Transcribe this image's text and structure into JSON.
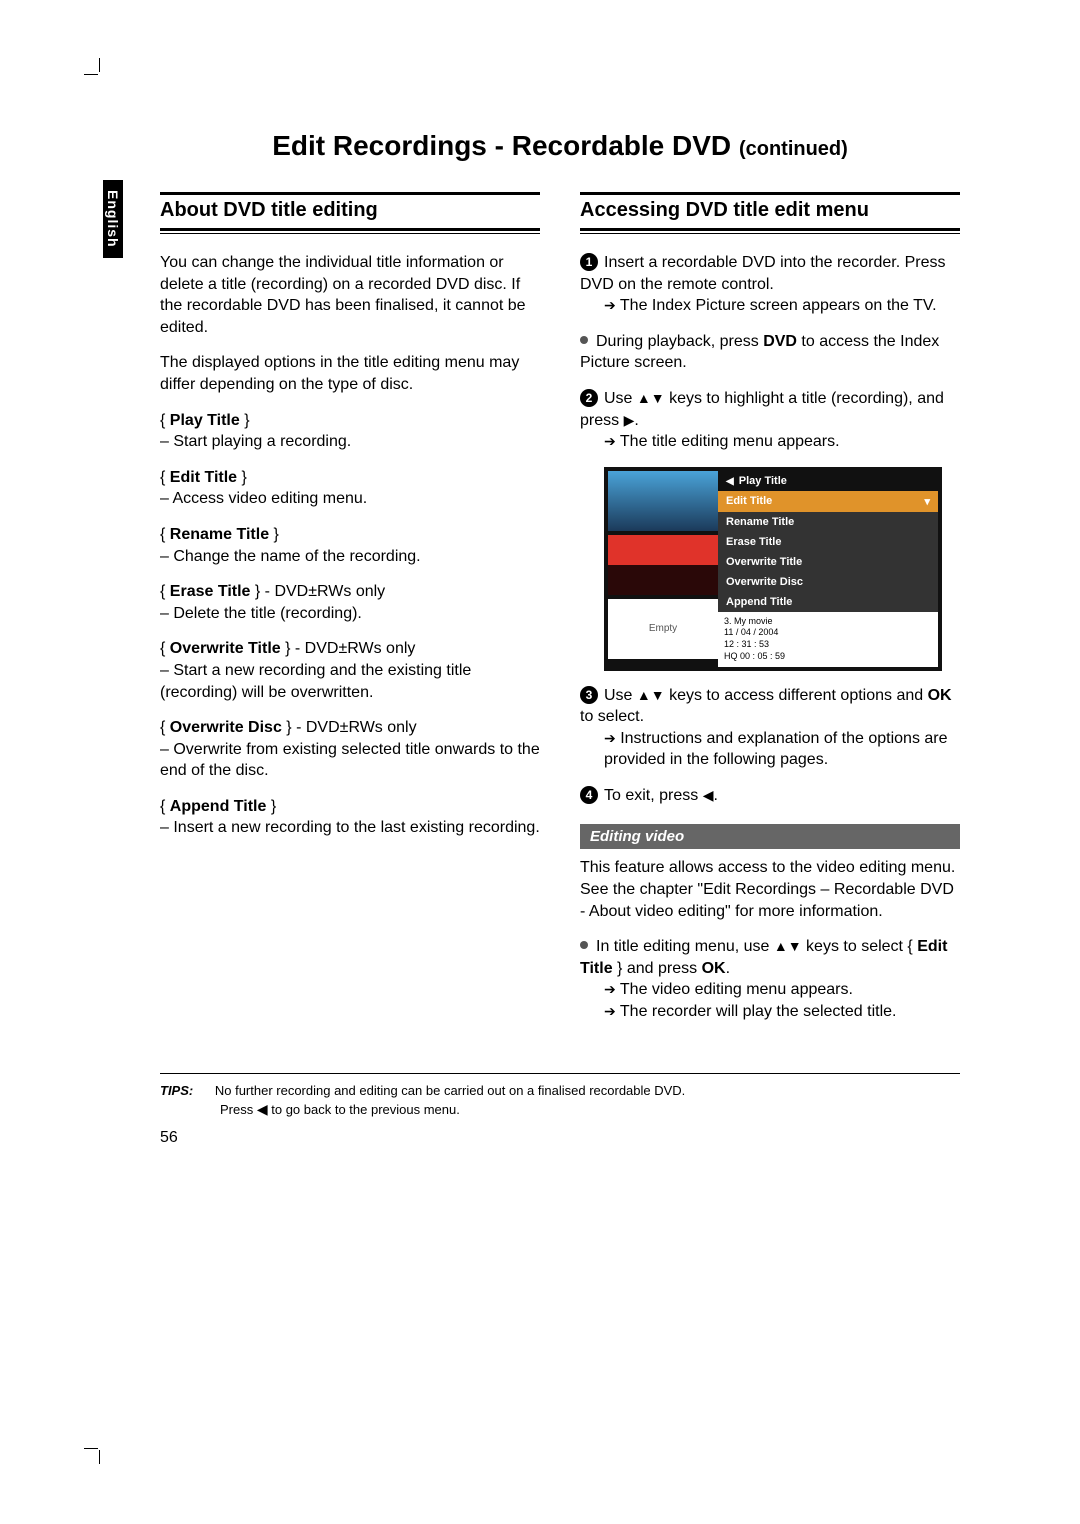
{
  "lang_tab": "English",
  "title_main": "Edit Recordings - Recordable DVD",
  "title_cont": "(continued)",
  "left": {
    "heading": "About DVD title editing",
    "para1": "You can change the individual title information or delete a title (recording) on a recorded DVD disc. If the recordable DVD has been finalised, it cannot be edited.",
    "para2": "The displayed options in the title editing menu may differ depending on the type of disc.",
    "options": [
      {
        "label": "Play Title",
        "suffix": "",
        "desc": "– Start playing a recording."
      },
      {
        "label": "Edit Title",
        "suffix": "",
        "desc": "– Access video editing menu."
      },
      {
        "label": "Rename Title",
        "suffix": "",
        "desc": "– Change the name of the recording."
      },
      {
        "label": "Erase Title",
        "suffix": " - DVD±RWs only",
        "desc": "– Delete the title (recording)."
      },
      {
        "label": "Overwrite Title",
        "suffix": " - DVD±RWs only",
        "desc": "– Start a new recording and the existing title (recording) will be overwritten."
      },
      {
        "label": "Overwrite Disc",
        "suffix": " - DVD±RWs only",
        "desc": "– Overwrite from existing selected title onwards to the end of the disc."
      },
      {
        "label": "Append Title",
        "suffix": "",
        "desc": "– Insert a new recording to the last existing recording."
      }
    ]
  },
  "right": {
    "heading": "Accessing DVD title edit menu",
    "step1a": "Insert a recordable DVD into the recorder. Press DVD on the remote control.",
    "step1b": "The Index Picture screen appears on the TV.",
    "bullet1_pre": "During playback, press ",
    "bullet1_bold": "DVD",
    "bullet1_post": " to access the Index Picture screen.",
    "step2a_pre": "Use ",
    "step2a_post": " keys to highlight a title (recording), and press ",
    "step2b": "The title editing menu appears.",
    "menu_items": [
      "Play Title",
      "Edit Title",
      "Rename Title",
      "Erase Title",
      "Overwrite Title",
      "Overwrite Disc",
      "Append Title"
    ],
    "menu_meta_line1": "3. My movie",
    "menu_meta_line2": "11 / 04 / 2004",
    "menu_meta_line3": "12 : 31 : 53",
    "menu_meta_line4": "HQ 00 : 05 : 59",
    "thumb_empty": "Empty",
    "step3a_pre": "Use ",
    "step3a_mid": " keys to access different options and ",
    "step3a_bold": "OK",
    "step3a_post": " to select.",
    "step3b": "Instructions and explanation of the options are provided in the following pages.",
    "step4": "To exit, press ",
    "sub_heading": "Editing video",
    "sub_para": "This feature allows access to the video editing menu. See the chapter  \"Edit Recordings – Recordable DVD - About video editing\"  for more information.",
    "sub_bullet_pre": "In title editing menu, use ",
    "sub_bullet_mid": " keys to select { ",
    "sub_bullet_bold1": "Edit Title",
    "sub_bullet_mid2": " } and press ",
    "sub_bullet_bold2": "OK",
    "sub_bullet_post": ".",
    "sub_res1": "The video editing menu appears.",
    "sub_res2": "The recorder will play the selected title."
  },
  "tips": {
    "label": "TIPS:",
    "line1": "No further recording and editing can be carried out on a finalised recordable DVD.",
    "line2_pre": "Press ",
    "line2_post": " to go back to the previous menu."
  },
  "page_number": "56"
}
